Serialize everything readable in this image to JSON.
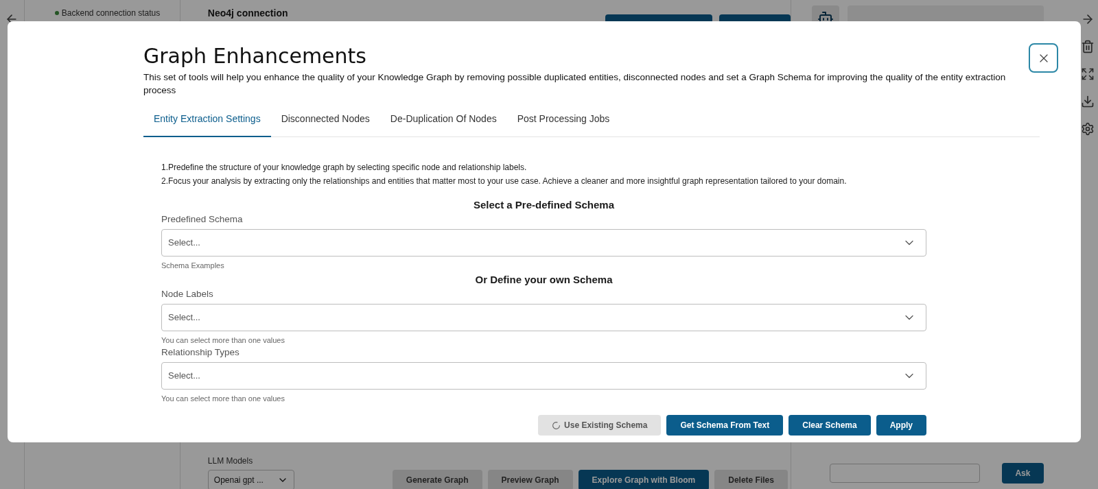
{
  "background": {
    "status": {
      "label": "Backend connection status",
      "connected": true
    },
    "connection_title": "Neo4j connection",
    "llm_models": {
      "label": "LLM Models",
      "value": "Openai gpt ..."
    },
    "actions": [
      {
        "label": "Generate Graph",
        "disabled": true
      },
      {
        "label": "Preview Graph",
        "disabled": true
      },
      {
        "label": "Explore Graph with Bloom",
        "disabled": false
      },
      {
        "label": "Delete Files",
        "disabled": true
      }
    ],
    "chat": {
      "button": "Ask"
    }
  },
  "dialog": {
    "title": "Graph Enhancements",
    "description": "This set of tools will help you enhance the quality of your Knowledge Graph by removing possible duplicated entities, disconnected nodes and set a Graph Schema for improving the quality of the entity extraction process",
    "tabs": [
      {
        "label": "Entity Extraction Settings",
        "selected": true
      },
      {
        "label": "Disconnected Nodes",
        "selected": false
      },
      {
        "label": "De-Duplication Of Nodes",
        "selected": false
      },
      {
        "label": "Post Processing Jobs",
        "selected": false
      }
    ],
    "notes": [
      "1.Predefine the structure of your knowledge graph by selecting specific node and relationship labels.",
      "2.Focus your analysis by extracting only the relationships and entities that matter most to your use case. Achieve a cleaner and more insightful graph representation tailored to your domain."
    ],
    "sections": [
      {
        "kind": "heading",
        "text": "Select a Pre-defined Schema"
      },
      {
        "kind": "field",
        "label": "Predefined Schema",
        "placeholder": "Select...",
        "hint": "Schema Examples"
      },
      {
        "kind": "heading",
        "text": "Or Define your own Schema"
      },
      {
        "kind": "field",
        "label": "Node Labels",
        "placeholder": "Select...",
        "hint": "You can select more than one values"
      },
      {
        "kind": "field",
        "label": "Relationship Types",
        "placeholder": "Select...",
        "hint": "You can select more than one values"
      }
    ],
    "buttons": [
      {
        "label": "Use Existing Schema",
        "disabled": true,
        "loading": true
      },
      {
        "label": "Get Schema From Text",
        "disabled": false,
        "loading": false
      },
      {
        "label": "Clear Schema",
        "disabled": false,
        "loading": false
      },
      {
        "label": "Apply",
        "disabled": false,
        "loading": false
      }
    ]
  }
}
